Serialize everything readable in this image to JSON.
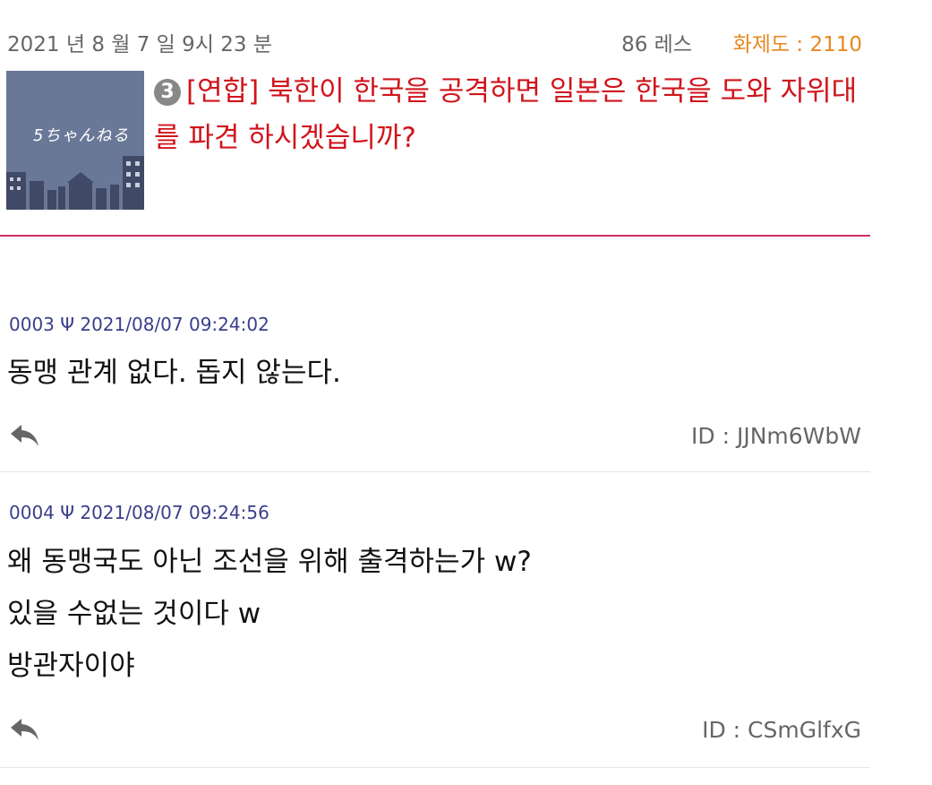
{
  "thread": {
    "date": "2021 년 8 월 7 일 9시 23 분",
    "res_count": "86 레스",
    "heat": "화제도 : 2110",
    "rank": "3",
    "title": "[연합] 북한이 한국을 공격하면 일본은 한국을 도와 자위대를 파견 하시겠습니까?",
    "thumbnail_text": "5ちゃんねる"
  },
  "posts": [
    {
      "header": "0003 Ψ 2021/08/07 09:24:02",
      "lines": [
        "동맹 관계 없다. 돕지 않는다."
      ],
      "id": "ID : JJNm6WbW"
    },
    {
      "header": "0004 Ψ 2021/08/07 09:24:56",
      "lines": [
        "왜 동맹국도 아닌 조선을 위해 출격하는가 w?",
        "있을 수없는 것이다 w",
        "방관자이야"
      ],
      "id": "ID : CSmGlfxG"
    }
  ],
  "colors": {
    "title": "#d0141c",
    "heat": "#e8871e",
    "divider": "#cc2d6a",
    "post_header": "#3a3f8a"
  }
}
